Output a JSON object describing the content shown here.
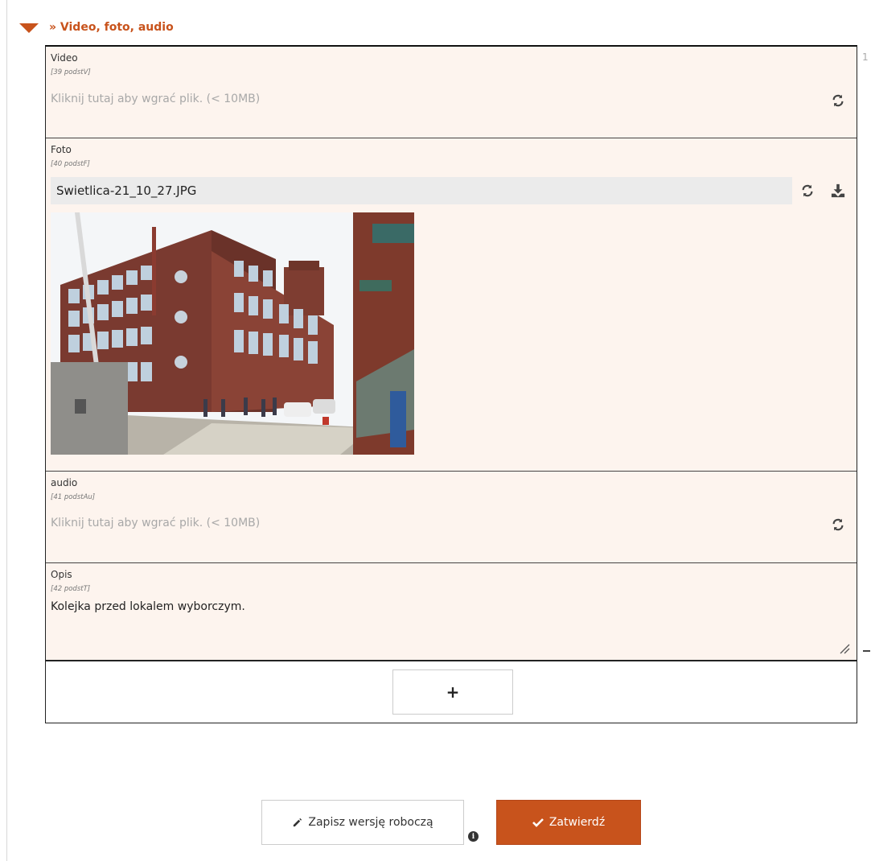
{
  "section": {
    "title": "» Video, foto, audio"
  },
  "fields": {
    "video": {
      "label": "Video",
      "code": "[39 podstV]",
      "upload_hint": "Kliknij tutaj aby wgrać plik. (< 10MB)"
    },
    "foto": {
      "label": "Foto",
      "code": "[40 podstF]",
      "file_name": "Swietlica-21_10_27.JPG"
    },
    "audio": {
      "label": "audio",
      "code": "[41 podstAu]",
      "upload_hint": "Kliknij tutaj aby wgrać plik. (< 10MB)"
    },
    "opis": {
      "label": "Opis",
      "code": "[42 podstT]",
      "value": "Kolejka przed lokalem wyborczym."
    }
  },
  "add_button": {
    "label": "+"
  },
  "right_marker": "1",
  "actions": {
    "draft_label": "Zapisz wersję roboczą",
    "confirm_label": "Zatwierdź",
    "info_glyph": "i"
  },
  "colors": {
    "accent": "#c8531c",
    "row_background": "#fdf4ee",
    "file_bar": "#ebebeb"
  },
  "icons": [
    "caret-down-icon",
    "refresh-icon",
    "download-icon",
    "resize-grip-icon",
    "pencil-icon",
    "check-icon",
    "info-icon"
  ]
}
